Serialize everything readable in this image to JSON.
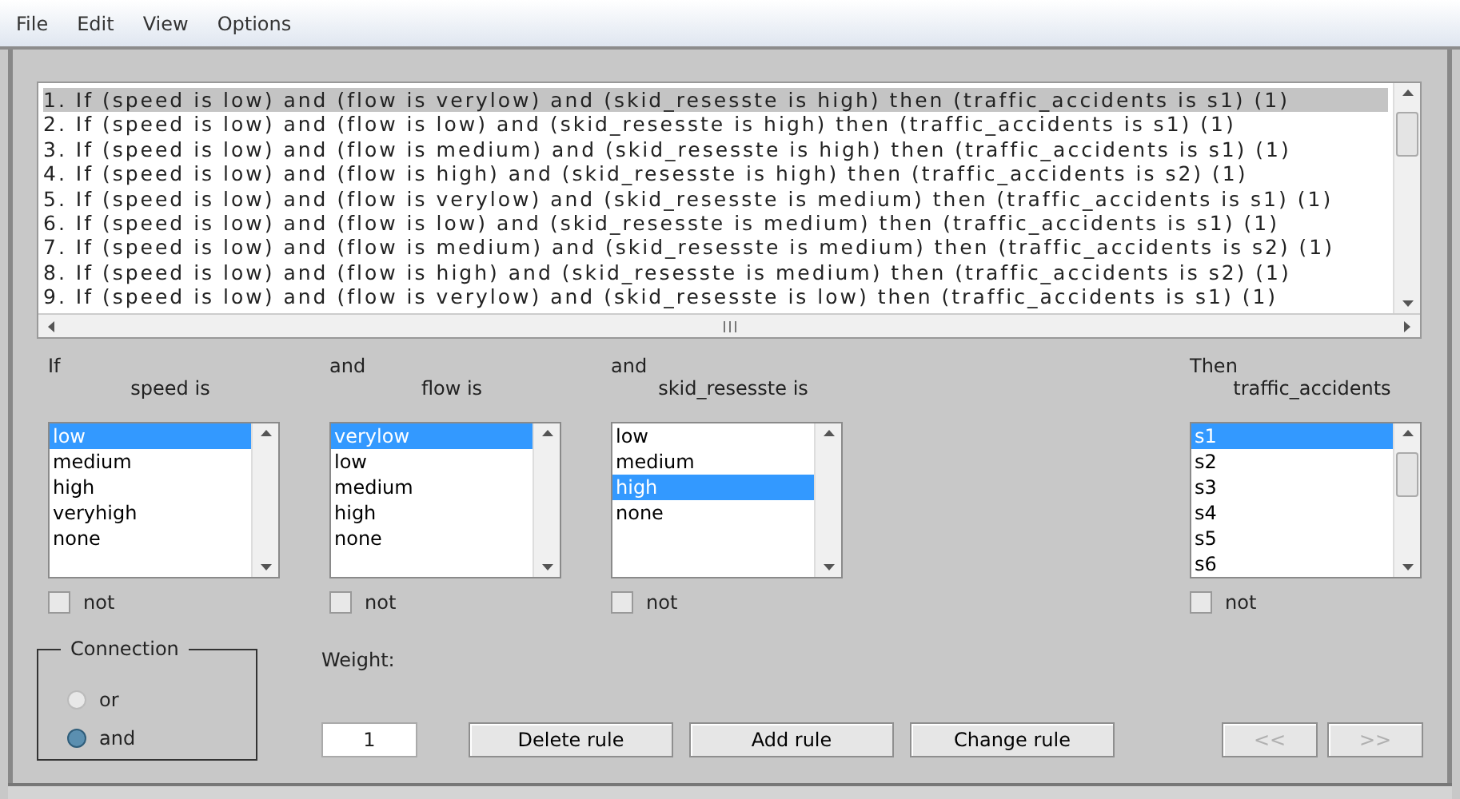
{
  "menu": [
    "File",
    "Edit",
    "View",
    "Options"
  ],
  "rules": [
    {
      "text": "1. If (speed is low) and (flow is verylow) and (skid_resesste is high) then (traffic_accidents is s1) (1)",
      "selected": true
    },
    {
      "text": "2. If (speed is low) and (flow is low) and (skid_resesste is high) then (traffic_accidents is s1) (1)",
      "selected": false
    },
    {
      "text": "3. If (speed is low) and (flow is medium) and (skid_resesste is high) then (traffic_accidents is s1) (1)",
      "selected": false
    },
    {
      "text": "4. If (speed is low) and (flow is high) and (skid_resesste is high) then (traffic_accidents is s2) (1)",
      "selected": false
    },
    {
      "text": "5. If (speed is low) and (flow is verylow) and (skid_resesste is medium) then (traffic_accidents is s1) (1)",
      "selected": false
    },
    {
      "text": "6. If (speed is low) and (flow is low) and (skid_resesste is medium) then (traffic_accidents is s1) (1)",
      "selected": false
    },
    {
      "text": "7. If (speed is low) and (flow is medium) and (skid_resesste is medium) then (traffic_accidents is s2) (1)",
      "selected": false
    },
    {
      "text": "8. If (speed is low) and (flow is high) and (skid_resesste is medium) then (traffic_accidents is s2) (1)",
      "selected": false
    },
    {
      "text": "9. If (speed is low) and (flow is verylow) and (skid_resesste is low) then (traffic_accidents is s1) (1)",
      "selected": false
    }
  ],
  "antecedents": [
    {
      "connector": "If",
      "label": "speed is",
      "not": false,
      "not_label": "not",
      "options": [
        {
          "label": "low",
          "selected": true
        },
        {
          "label": "medium",
          "selected": false
        },
        {
          "label": "high",
          "selected": false
        },
        {
          "label": "veryhigh",
          "selected": false
        },
        {
          "label": "none",
          "selected": false
        }
      ]
    },
    {
      "connector": "and",
      "label": "flow is",
      "not": false,
      "not_label": "not",
      "options": [
        {
          "label": "verylow",
          "selected": true
        },
        {
          "label": "low",
          "selected": false
        },
        {
          "label": "medium",
          "selected": false
        },
        {
          "label": "high",
          "selected": false
        },
        {
          "label": "none",
          "selected": false
        }
      ]
    },
    {
      "connector": "and",
      "label": "skid_resesste is",
      "not": false,
      "not_label": "not",
      "options": [
        {
          "label": "low",
          "selected": false
        },
        {
          "label": "medium",
          "selected": false
        },
        {
          "label": "high",
          "selected": true
        },
        {
          "label": "none",
          "selected": false
        }
      ]
    }
  ],
  "consequent": {
    "connector": "Then",
    "label": "traffic_accidents",
    "not": false,
    "not_label": "not",
    "options": [
      {
        "label": "s1",
        "selected": true
      },
      {
        "label": "s2",
        "selected": false
      },
      {
        "label": "s3",
        "selected": false
      },
      {
        "label": "s4",
        "selected": false
      },
      {
        "label": "s5",
        "selected": false
      },
      {
        "label": "s6",
        "selected": false
      }
    ]
  },
  "connection": {
    "title": "Connection",
    "options": [
      {
        "label": "or",
        "selected": false
      },
      {
        "label": "and",
        "selected": true
      }
    ]
  },
  "weight": {
    "label": "Weight:",
    "value": "1"
  },
  "buttons": [
    {
      "label": "Delete rule",
      "disabled": false
    },
    {
      "label": "Add rule",
      "disabled": false
    },
    {
      "label": "Change rule",
      "disabled": false
    }
  ],
  "nav_buttons": [
    {
      "label": "<<",
      "disabled": true
    },
    {
      "label": ">>",
      "disabled": true
    }
  ]
}
